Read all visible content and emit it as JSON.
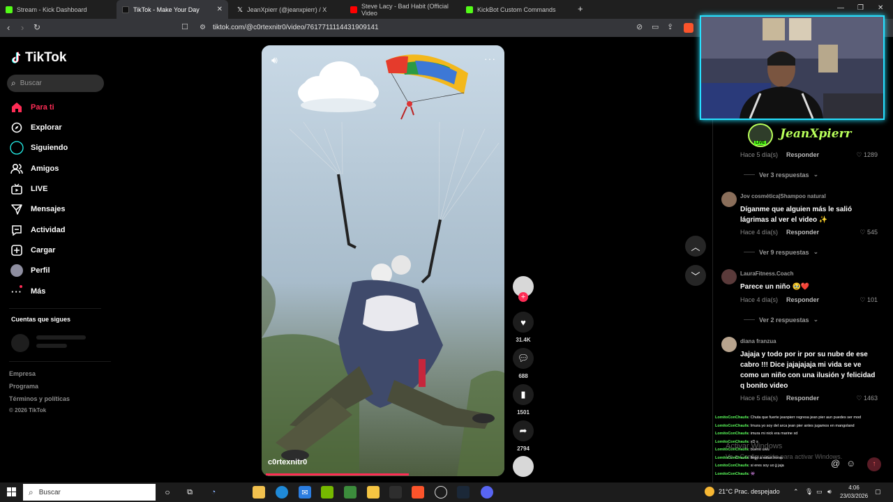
{
  "browser": {
    "tabs": [
      {
        "title": "Stream - Kick Dashboard",
        "favicon_color": "#53fc18"
      },
      {
        "title": "TikTok - Make Your Day",
        "favicon_color": "#111111"
      },
      {
        "title": "JeanXpierr (@jeanxpierr) / X",
        "favicon_color": "#000000"
      },
      {
        "title": "Steve Lacy - Bad Habit (Official Video",
        "favicon_color": "#ff0000"
      },
      {
        "title": "KickBot Custom Commands",
        "favicon_color": "#53fc18"
      }
    ],
    "new_tab": "+",
    "url": "tiktok.com/@c0rtexnitr0/video/7617711114431909141"
  },
  "sidebar": {
    "logo": "TikTok",
    "search_placeholder": "Buscar",
    "nav": [
      {
        "label": "Para ti",
        "icon": "home-icon"
      },
      {
        "label": "Explorar",
        "icon": "compass-icon"
      },
      {
        "label": "Siguiendo",
        "icon": "following-icon"
      },
      {
        "label": "Amigos",
        "icon": "friends-icon"
      },
      {
        "label": "LIVE",
        "icon": "live-icon"
      },
      {
        "label": "Mensajes",
        "icon": "messages-icon"
      },
      {
        "label": "Actividad",
        "icon": "activity-icon"
      },
      {
        "label": "Cargar",
        "icon": "upload-icon"
      },
      {
        "label": "Perfil",
        "icon": "profile-icon"
      },
      {
        "label": "Más",
        "icon": "more-icon"
      }
    ],
    "following_title": "Cuentas que sigues",
    "footer": [
      "Empresa",
      "Programa",
      "Términos y políticas",
      "© 2026 TikTok"
    ]
  },
  "video": {
    "author": "c0rtexnitr0",
    "progress": 0.61,
    "actions": {
      "likes": "31.4K",
      "comments": "688",
      "saves": "1501",
      "shares": "2794"
    }
  },
  "comments": [
    {
      "user": "",
      "text": "",
      "time": "Hace 5 día(s)",
      "reply": "Responder",
      "likes": "1289",
      "replies": "Ver 3 respuestas"
    },
    {
      "user": "Jov cosmética|Shampoo natural",
      "text": "Díganme que alguien más le salió lágrimas al ver el video ✨",
      "time": "Hace 4 día(s)",
      "reply": "Responder",
      "likes": "545",
      "replies": "Ver 9 respuestas"
    },
    {
      "user": "LauraFitness.Coach",
      "text": "Parece un niño 🥹❤️",
      "time": "Hace 4 día(s)",
      "reply": "Responder",
      "likes": "101",
      "replies": "Ver 2 respuestas"
    },
    {
      "user": "diana franzua",
      "text": "Jajaja y todo por ir por su nube de ese cabro !!! Dice jajajajaja mi vida se ve como un niño con una ilusión y felicidad q bonito video",
      "time": "Hace 5 día(s)",
      "reply": "Responder",
      "likes": "1463",
      "replies": ""
    }
  ],
  "stream": {
    "streamer_name": "JeanXpierr",
    "live_badge": "LIVE",
    "chat": [
      {
        "user": "LomitoConChaufa",
        "msg": ": Chuta que fuerte jeanpierr regresa jean pier aun puedes ser mod"
      },
      {
        "user": "LomitoConChaufa",
        "msg": ": Imura yo soy del arca jean pier antes jugamos en mangoland"
      },
      {
        "user": "LomitoConChaufa",
        "msg": ": imura mi nick era marine xd"
      },
      {
        "user": "LomitoConChaufa",
        "msg": ": xD s"
      },
      {
        "user": "LomitoConChaufa",
        "msg": ": bueno uwu"
      },
      {
        "user": "LomitoConChaufa",
        "msg": ": llego a estas horas"
      },
      {
        "user": "LomitoConChaufa",
        "msg": ": si eres soy uo jj jaja"
      },
      {
        "user": "LomitoConChaufa",
        "msg": ": 👾"
      }
    ],
    "watermark_line1": "Activar Windows",
    "watermark_line2": "Ve a Configuración para activar Windows."
  },
  "taskbar": {
    "search": "Buscar",
    "weather": "21°C  Prac. despejado",
    "time": "4:06",
    "date": "23/03/2026"
  }
}
